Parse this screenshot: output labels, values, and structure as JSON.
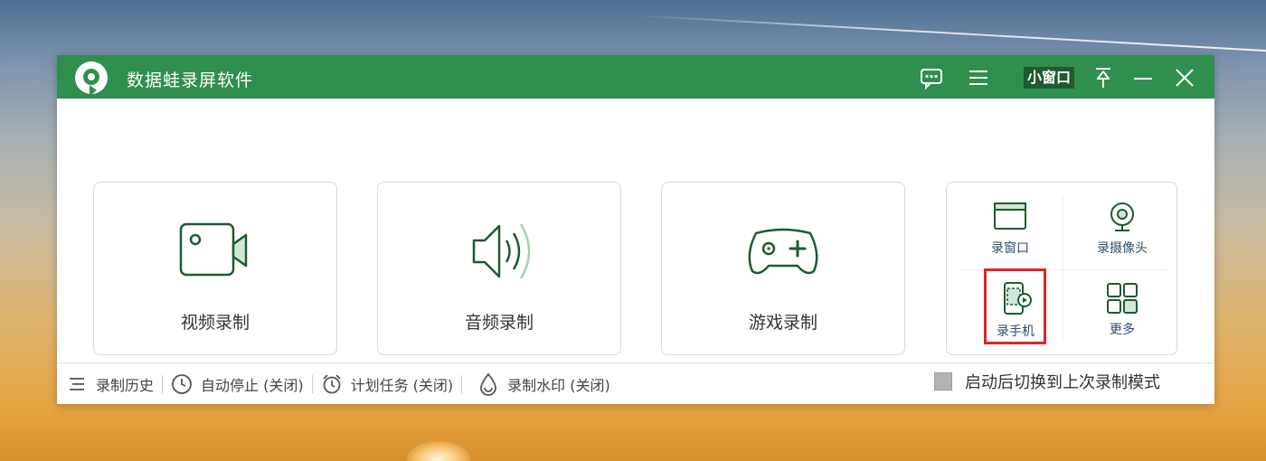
{
  "app": {
    "title": "数据蛙录屏软件",
    "small_window_label": "小窗口"
  },
  "titlebar_icons": [
    "chat-icon",
    "menu-icon",
    "pin-icon",
    "minimize-icon",
    "close-icon"
  ],
  "main_modes": [
    {
      "label": "视频录制",
      "icon": "video-camera-icon"
    },
    {
      "label": "音频录制",
      "icon": "speaker-icon"
    },
    {
      "label": "游戏录制",
      "icon": "gamepad-icon"
    }
  ],
  "quick_modes": [
    {
      "label": "录窗口",
      "icon": "window-icon"
    },
    {
      "label": "录摄像头",
      "icon": "webcam-icon"
    },
    {
      "label": "录手机",
      "icon": "phone-record-icon",
      "highlighted": true
    },
    {
      "label": "更多",
      "icon": "grid-more-icon"
    }
  ],
  "switch_option": {
    "label": "启动后切换到上次录制模式",
    "checked": false
  },
  "bottom_bar": [
    {
      "label": "录制历史",
      "icon": "history-list-icon"
    },
    {
      "label": "自动停止 (关闭)",
      "icon": "clock-icon"
    },
    {
      "label": "计划任务 (关闭)",
      "icon": "alarm-clock-icon"
    },
    {
      "label": "录制水印 (关闭)",
      "icon": "watermark-drop-icon"
    }
  ],
  "colors": {
    "title_bar": "#2f8f4e",
    "accent_green": "#2f8f4e",
    "highlight_red": "#e0242a"
  }
}
